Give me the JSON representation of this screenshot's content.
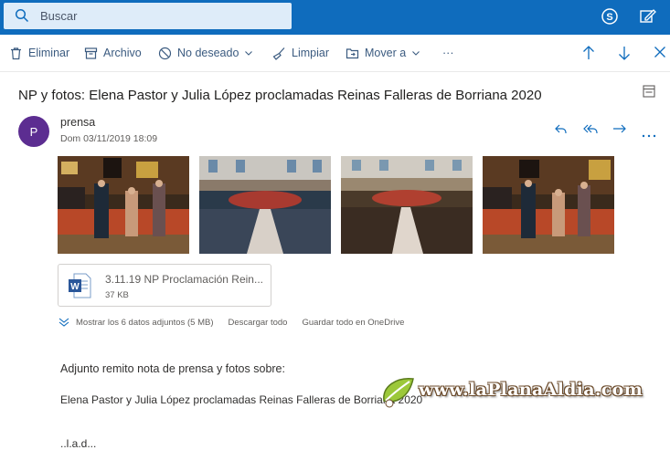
{
  "search": {
    "placeholder": "Buscar"
  },
  "toolbar": {
    "delete": "Eliminar",
    "archive": "Archivo",
    "junk": "No deseado",
    "sweep": "Limpiar",
    "move": "Mover a",
    "more": "···"
  },
  "message": {
    "subject": "NP y fotos: Elena Pastor y Julia López proclamadas Reinas Falleras de Borriana 2020",
    "avatar_initial": "P",
    "sender": "prensa",
    "date": "Dom 03/11/2019 18:09"
  },
  "attachment": {
    "name": "3.11.19 NP Proclamación Rein...",
    "size": "37 KB",
    "show_all": "Mostrar los 6 datos adjuntos (5 MB)",
    "download_all": "Descargar todo",
    "save_onedrive": "Guardar todo en OneDrive"
  },
  "body": {
    "line1": "Adjunto remito nota de prensa y fotos sobre:",
    "line2": "Elena Pastor y Julia López proclamadas Reinas Falleras de Borriana 2020",
    "line3": "..l.a.d..."
  },
  "watermark": {
    "text": "www.laPlanaAldia.com"
  },
  "colors": {
    "accent": "#0f6cbd",
    "avatar": "#5c2d91",
    "word": "#2b579a"
  }
}
